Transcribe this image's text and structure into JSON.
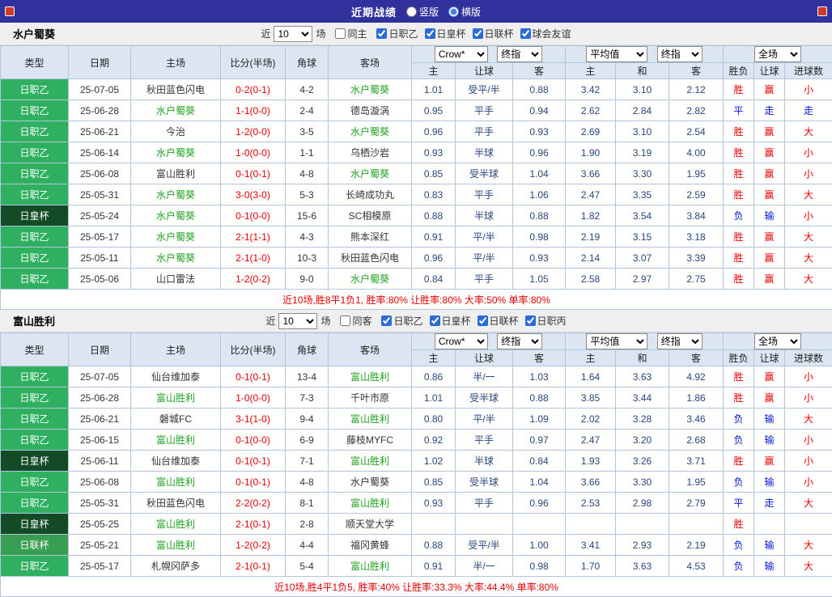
{
  "topbar": {
    "title": "近期战绩",
    "radios": [
      {
        "label": "竖版",
        "checked": false
      },
      {
        "label": "横版",
        "checked": true
      }
    ]
  },
  "labels": {
    "recent": "近",
    "games": "场"
  },
  "controls": {
    "crow": "Crow*",
    "final": "终指",
    "avg": "平均值",
    "full": "全场"
  },
  "columns": {
    "type": "类型",
    "date": "日期",
    "home": "主场",
    "score": "比分(半场)",
    "corner": "角球",
    "away": "客场",
    "sub": [
      "主",
      "让球",
      "客",
      "主",
      "和",
      "客",
      "胜负",
      "让球",
      "进球数"
    ]
  },
  "colors": {
    "topbar_bg": "#31319e",
    "header_bg": "#dce6f2",
    "grid_line": "#b3c6e0",
    "league_j2": "#2fb060",
    "league_emperor_cup": "#134b27",
    "league_levain_cup": "#379e52",
    "win_red": "#ee0000",
    "lose_blue": "#0017d8",
    "score_red": "#e60000",
    "focus_team_green": "#22a322",
    "odds_navy": "#27477e"
  },
  "sections": [
    {
      "team": "水户蜀葵",
      "filter": {
        "count": "10",
        "same_label": "同主",
        "same_checked": false,
        "leagues": [
          {
            "label": "日职乙",
            "checked": true
          },
          {
            "label": "日皇杯",
            "checked": true
          },
          {
            "label": "日联杯",
            "checked": true
          },
          {
            "label": "球会友谊",
            "checked": true
          }
        ]
      },
      "rows": [
        {
          "league": "日职乙",
          "date": "25-07-05",
          "home": "秋田蓝色闪电",
          "home_focus": false,
          "score": "0-2(0-1)",
          "corner": "4-2",
          "away": "水户蜀葵",
          "away_focus": true,
          "odds": [
            "1.01",
            "受平/半",
            "0.88",
            "3.42",
            "3.10",
            "2.12"
          ],
          "result": [
            "胜",
            "赢",
            "小"
          ]
        },
        {
          "league": "日职乙",
          "date": "25-06-28",
          "home": "水户蜀葵",
          "home_focus": true,
          "score": "1-1(0-0)",
          "corner": "2-4",
          "away": "德岛漩涡",
          "away_focus": false,
          "odds": [
            "0.95",
            "平手",
            "0.94",
            "2.62",
            "2.84",
            "2.82"
          ],
          "result": [
            "平",
            "走",
            "走"
          ]
        },
        {
          "league": "日职乙",
          "date": "25-06-21",
          "home": "今治",
          "home_focus": false,
          "score": "1-2(0-0)",
          "corner": "3-5",
          "away": "水户蜀葵",
          "away_focus": true,
          "odds": [
            "0.96",
            "平手",
            "0.93",
            "2.69",
            "3.10",
            "2.54"
          ],
          "result": [
            "胜",
            "赢",
            "大"
          ]
        },
        {
          "league": "日职乙",
          "date": "25-06-14",
          "home": "水户蜀葵",
          "home_focus": true,
          "score": "1-0(0-0)",
          "corner": "1-1",
          "away": "乌栖沙岩",
          "away_focus": false,
          "odds": [
            "0.93",
            "半球",
            "0.96",
            "1.90",
            "3.19",
            "4.00"
          ],
          "result": [
            "胜",
            "赢",
            "小"
          ]
        },
        {
          "league": "日职乙",
          "date": "25-06-08",
          "home": "富山胜利",
          "home_focus": false,
          "score": "0-1(0-1)",
          "corner": "4-8",
          "away": "水户蜀葵",
          "away_focus": true,
          "odds": [
            "0.85",
            "受半球",
            "1.04",
            "3.66",
            "3.30",
            "1.95"
          ],
          "result": [
            "胜",
            "赢",
            "小"
          ]
        },
        {
          "league": "日职乙",
          "date": "25-05-31",
          "home": "水户蜀葵",
          "home_focus": true,
          "score": "3-0(3-0)",
          "corner": "5-3",
          "away": "长崎成功丸",
          "away_focus": false,
          "odds": [
            "0.83",
            "平手",
            "1.06",
            "2.47",
            "3.35",
            "2.59"
          ],
          "result": [
            "胜",
            "赢",
            "大"
          ]
        },
        {
          "league": "日皇杯",
          "date": "25-05-24",
          "home": "水户蜀葵",
          "home_focus": true,
          "score": "0-1(0-0)",
          "corner": "15-6",
          "away": "SC相模原",
          "away_focus": false,
          "odds": [
            "0.88",
            "半球",
            "0.88",
            "1.82",
            "3.54",
            "3.84"
          ],
          "result": [
            "负",
            "输",
            "小"
          ]
        },
        {
          "league": "日职乙",
          "date": "25-05-17",
          "home": "水户蜀葵",
          "home_focus": true,
          "score": "2-1(1-1)",
          "corner": "4-3",
          "away": "熊本深红",
          "away_focus": false,
          "odds": [
            "0.91",
            "平/半",
            "0.98",
            "2.19",
            "3.15",
            "3.18"
          ],
          "result": [
            "胜",
            "赢",
            "大"
          ]
        },
        {
          "league": "日职乙",
          "date": "25-05-11",
          "home": "水户蜀葵",
          "home_focus": true,
          "score": "2-1(1-0)",
          "corner": "10-3",
          "away": "秋田蓝色闪电",
          "away_focus": false,
          "odds": [
            "0.96",
            "平/半",
            "0.93",
            "2.14",
            "3.07",
            "3.39"
          ],
          "result": [
            "胜",
            "赢",
            "大"
          ]
        },
        {
          "league": "日职乙",
          "date": "25-05-06",
          "home": "山口雷法",
          "home_focus": false,
          "score": "1-2(0-2)",
          "corner": "9-0",
          "away": "水户蜀葵",
          "away_focus": true,
          "odds": [
            "0.84",
            "平手",
            "1.05",
            "2.58",
            "2.97",
            "2.75"
          ],
          "result": [
            "胜",
            "赢",
            "大"
          ]
        }
      ],
      "summary": "近10场,胜8平1负1, 胜率:80% 让胜率:80% 大率:50% 单率:80%"
    },
    {
      "team": "富山胜利",
      "filter": {
        "count": "10",
        "same_label": "同客",
        "same_checked": false,
        "leagues": [
          {
            "label": "日职乙",
            "checked": true
          },
          {
            "label": "日皇杯",
            "checked": true
          },
          {
            "label": "日联杯",
            "checked": true
          },
          {
            "label": "日职丙",
            "checked": true
          }
        ]
      },
      "rows": [
        {
          "league": "日职乙",
          "date": "25-07-05",
          "home": "仙台维加泰",
          "home_focus": false,
          "score": "0-1(0-1)",
          "corner": "13-4",
          "away": "富山胜利",
          "away_focus": true,
          "odds": [
            "0.86",
            "半/一",
            "1.03",
            "1.64",
            "3.63",
            "4.92"
          ],
          "result": [
            "胜",
            "赢",
            "小"
          ]
        },
        {
          "league": "日职乙",
          "date": "25-06-28",
          "home": "富山胜利",
          "home_focus": true,
          "score": "1-0(0-0)",
          "corner": "7-3",
          "away": "千叶市原",
          "away_focus": false,
          "odds": [
            "1.01",
            "受半球",
            "0.88",
            "3.85",
            "3.44",
            "1.86"
          ],
          "result": [
            "胜",
            "赢",
            "小"
          ]
        },
        {
          "league": "日职乙",
          "date": "25-06-21",
          "home": "磐城FC",
          "home_focus": false,
          "score": "3-1(1-0)",
          "corner": "9-4",
          "away": "富山胜利",
          "away_focus": true,
          "odds": [
            "0.80",
            "平/半",
            "1.09",
            "2.02",
            "3.28",
            "3.46"
          ],
          "result": [
            "负",
            "输",
            "大"
          ]
        },
        {
          "league": "日职乙",
          "date": "25-06-15",
          "home": "富山胜利",
          "home_focus": true,
          "score": "0-1(0-0)",
          "corner": "6-9",
          "away": "藤枝MYFC",
          "away_focus": false,
          "odds": [
            "0.92",
            "平手",
            "0.97",
            "2.47",
            "3.20",
            "2.68"
          ],
          "result": [
            "负",
            "输",
            "小"
          ]
        },
        {
          "league": "日皇杯",
          "date": "25-06-11",
          "home": "仙台维加泰",
          "home_focus": false,
          "score": "0-1(0-1)",
          "corner": "7-1",
          "away": "富山胜利",
          "away_focus": true,
          "odds": [
            "1.02",
            "半球",
            "0.84",
            "1.93",
            "3.26",
            "3.71"
          ],
          "result": [
            "胜",
            "赢",
            "小"
          ]
        },
        {
          "league": "日职乙",
          "date": "25-06-08",
          "home": "富山胜利",
          "home_focus": true,
          "score": "0-1(0-1)",
          "corner": "4-8",
          "away": "水户蜀葵",
          "away_focus": false,
          "odds": [
            "0.85",
            "受半球",
            "1.04",
            "3.66",
            "3.30",
            "1.95"
          ],
          "result": [
            "负",
            "输",
            "小"
          ]
        },
        {
          "league": "日职乙",
          "date": "25-05-31",
          "home": "秋田蓝色闪电",
          "home_focus": false,
          "score": "2-2(0-2)",
          "corner": "8-1",
          "away": "富山胜利",
          "away_focus": true,
          "odds": [
            "0.93",
            "平手",
            "0.96",
            "2.53",
            "2.98",
            "2.79"
          ],
          "result": [
            "平",
            "走",
            "大"
          ]
        },
        {
          "league": "日皇杯",
          "date": "25-05-25",
          "home": "富山胜利",
          "home_focus": true,
          "score": "2-1(0-1)",
          "corner": "2-8",
          "away": "顺天堂大学",
          "away_focus": false,
          "odds": [
            "",
            "",
            "",
            "",
            "",
            ""
          ],
          "result": [
            "胜",
            "",
            ""
          ]
        },
        {
          "league": "日联杯",
          "date": "25-05-21",
          "home": "富山胜利",
          "home_focus": true,
          "score": "1-2(0-2)",
          "corner": "4-4",
          "away": "福冈黄蜂",
          "away_focus": false,
          "odds": [
            "0.88",
            "受平/半",
            "1.00",
            "3.41",
            "2.93",
            "2.19"
          ],
          "result": [
            "负",
            "输",
            "大"
          ]
        },
        {
          "league": "日职乙",
          "date": "25-05-17",
          "home": "札幌冈萨多",
          "home_focus": false,
          "score": "2-1(0-1)",
          "corner": "5-4",
          "away": "富山胜利",
          "away_focus": true,
          "odds": [
            "0.91",
            "半/一",
            "0.98",
            "1.70",
            "3.63",
            "4.53"
          ],
          "result": [
            "负",
            "输",
            "大"
          ]
        }
      ],
      "summary": "近10场,胜4平1负5, 胜率:40% 让胜率:33.3% 大率:44.4% 单率:80%"
    }
  ]
}
